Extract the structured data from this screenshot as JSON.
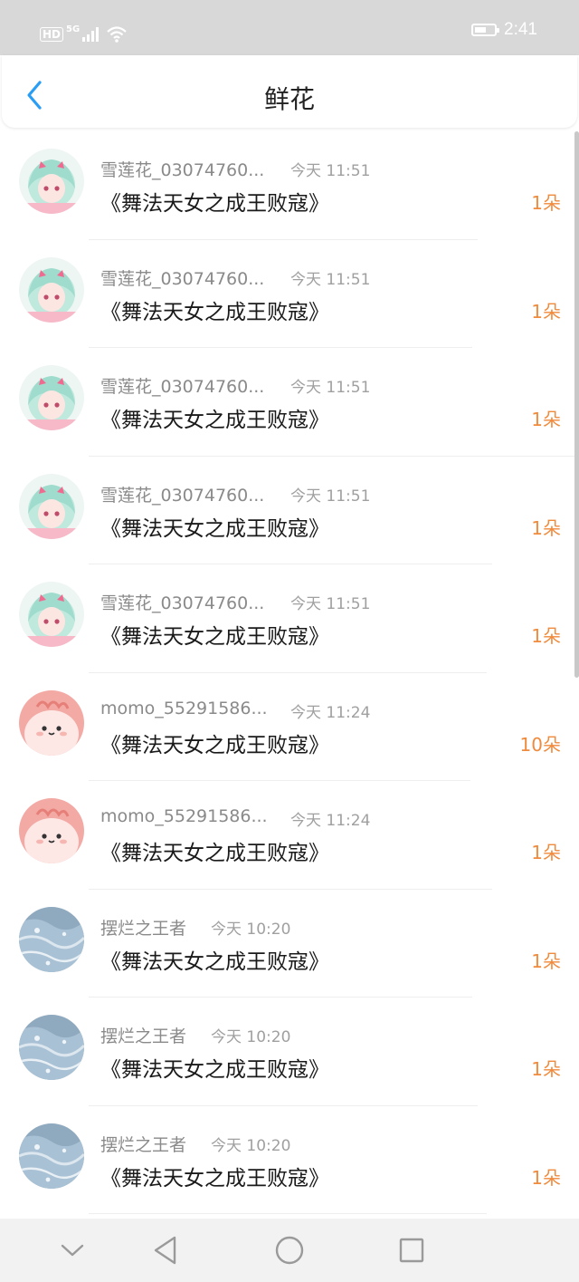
{
  "status": {
    "hd": "HD",
    "network": "5G",
    "time": "2:41"
  },
  "header": {
    "title": "鲜花"
  },
  "colors": {
    "accent_blue": "#2a9df4",
    "count_orange": "#f08a3c"
  },
  "items": [
    {
      "name": "雪莲花_03074760...",
      "time": "今天 11:51",
      "book": "《舞法天女之成王败寇》",
      "count": "1朵",
      "avatar": "anime-girl-avatar"
    },
    {
      "name": "雪莲花_03074760...",
      "time": "今天 11:51",
      "book": "《舞法天女之成王败寇》",
      "count": "1朵",
      "avatar": "anime-girl-avatar"
    },
    {
      "name": "雪莲花_03074760...",
      "time": "今天 11:51",
      "book": "《舞法天女之成王败寇》",
      "count": "1朵",
      "avatar": "anime-girl-avatar"
    },
    {
      "name": "雪莲花_03074760...",
      "time": "今天 11:51",
      "book": "《舞法天女之成王败寇》",
      "count": "1朵",
      "avatar": "anime-girl-avatar"
    },
    {
      "name": "雪莲花_03074760...",
      "time": "今天 11:51",
      "book": "《舞法天女之成王败寇》",
      "count": "1朵",
      "avatar": "anime-girl-avatar"
    },
    {
      "name": "momo_55291586...",
      "time": "今天 11:24",
      "book": "《舞法天女之成王败寇》",
      "count": "10朵",
      "avatar": "pink-blob-avatar"
    },
    {
      "name": "momo_55291586...",
      "time": "今天 11:24",
      "book": "《舞法天女之成王败寇》",
      "count": "1朵",
      "avatar": "pink-blob-avatar"
    },
    {
      "name": "摆烂之王者",
      "time": "今天 10:20",
      "book": "《舞法天女之成王败寇》",
      "count": "1朵",
      "avatar": "water-texture-avatar"
    },
    {
      "name": "摆烂之王者",
      "time": "今天 10:20",
      "book": "《舞法天女之成王败寇》",
      "count": "1朵",
      "avatar": "water-texture-avatar"
    },
    {
      "name": "摆烂之王者",
      "time": "今天 10:20",
      "book": "《舞法天女之成王败寇》",
      "count": "1朵",
      "avatar": "water-texture-avatar"
    }
  ]
}
